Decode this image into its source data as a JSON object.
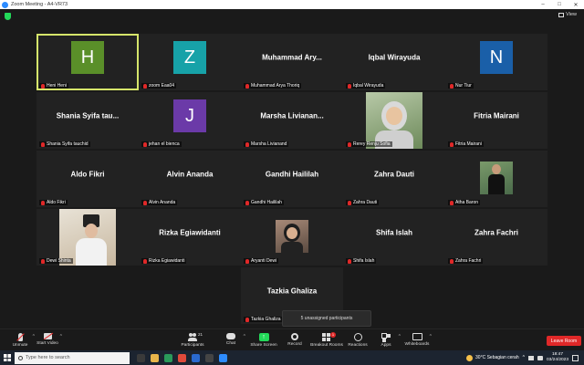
{
  "window": {
    "title": "Zoom Meeting - A4-VR73",
    "controls": [
      "–",
      "□",
      "✕"
    ]
  },
  "view_button": {
    "label": "View"
  },
  "tiles": [
    {
      "name": "Heni Heni",
      "initial": "H",
      "avatar_color": "#5a8f29",
      "active": true
    },
    {
      "name": "zoom Eaa04",
      "initial": "Z",
      "avatar_color": "#17a2a8"
    },
    {
      "name": "Muhammad Arya Thoriq",
      "display": "Muhammad  Ary..."
    },
    {
      "name": "Iqbal Wirayuda",
      "display": "Iqbal Wirayuda"
    },
    {
      "name": "Nur Tiur",
      "initial": "N",
      "avatar_color": "#1a5fa8"
    },
    {
      "name": "Shania Syifa tauchid",
      "display": "Shania  Syifa  tau..."
    },
    {
      "name": "jehan el bienca",
      "initial": "J",
      "avatar_color": "#6b3aa8"
    },
    {
      "name": "Marsha Livianand",
      "display": "Marsha  Livianan..."
    },
    {
      "name": "Rerey Renju Sofia",
      "photo": true
    },
    {
      "name": "Fitria Mairani",
      "display": "Fitria Mairani"
    },
    {
      "name": "Aldo Fikri",
      "display": "Aldo Fikri"
    },
    {
      "name": "Alvin Ananda",
      "display": "Alvin Ananda"
    },
    {
      "name": "Gandhi Haililah",
      "display": "Gandhi Haililah"
    },
    {
      "name": "Zahra Dauti",
      "display": "Zahra Dauti"
    },
    {
      "name": "Atha Baron",
      "photo": true
    },
    {
      "name": "Dewi Shinta",
      "photo": true
    },
    {
      "name": "Rizka Egiawidanti",
      "display": "Rizka Egiawidanti"
    },
    {
      "name": "Aryanti Dewi",
      "photo": true
    },
    {
      "name": "Shifa Islah",
      "display": "Shifa Islah"
    },
    {
      "name": "Zahra Fachri",
      "display": "Zahra Fachri"
    },
    {
      "name": "Tazkia Ghaliza",
      "display": "Tazkia Ghaliza"
    }
  ],
  "unassigned_text": "5 unassigned participants",
  "toolbar": {
    "unmute": "Unmute",
    "start_video": "Start Video",
    "participants": "Participants",
    "participants_count": "21",
    "chat": "Chat",
    "share_screen": "Share Screen",
    "record": "Record",
    "breakout_rooms": "Breakout Rooms",
    "breakout_badge": "1",
    "reactions": "Reactions",
    "apps": "Apps",
    "whiteboards": "Whiteboards",
    "leave": "Leave Room"
  },
  "taskbar": {
    "search_placeholder": "Type here to search",
    "weather": "30°C  Sebagian cerah",
    "time": "18:47",
    "date": "03/24/2023"
  }
}
